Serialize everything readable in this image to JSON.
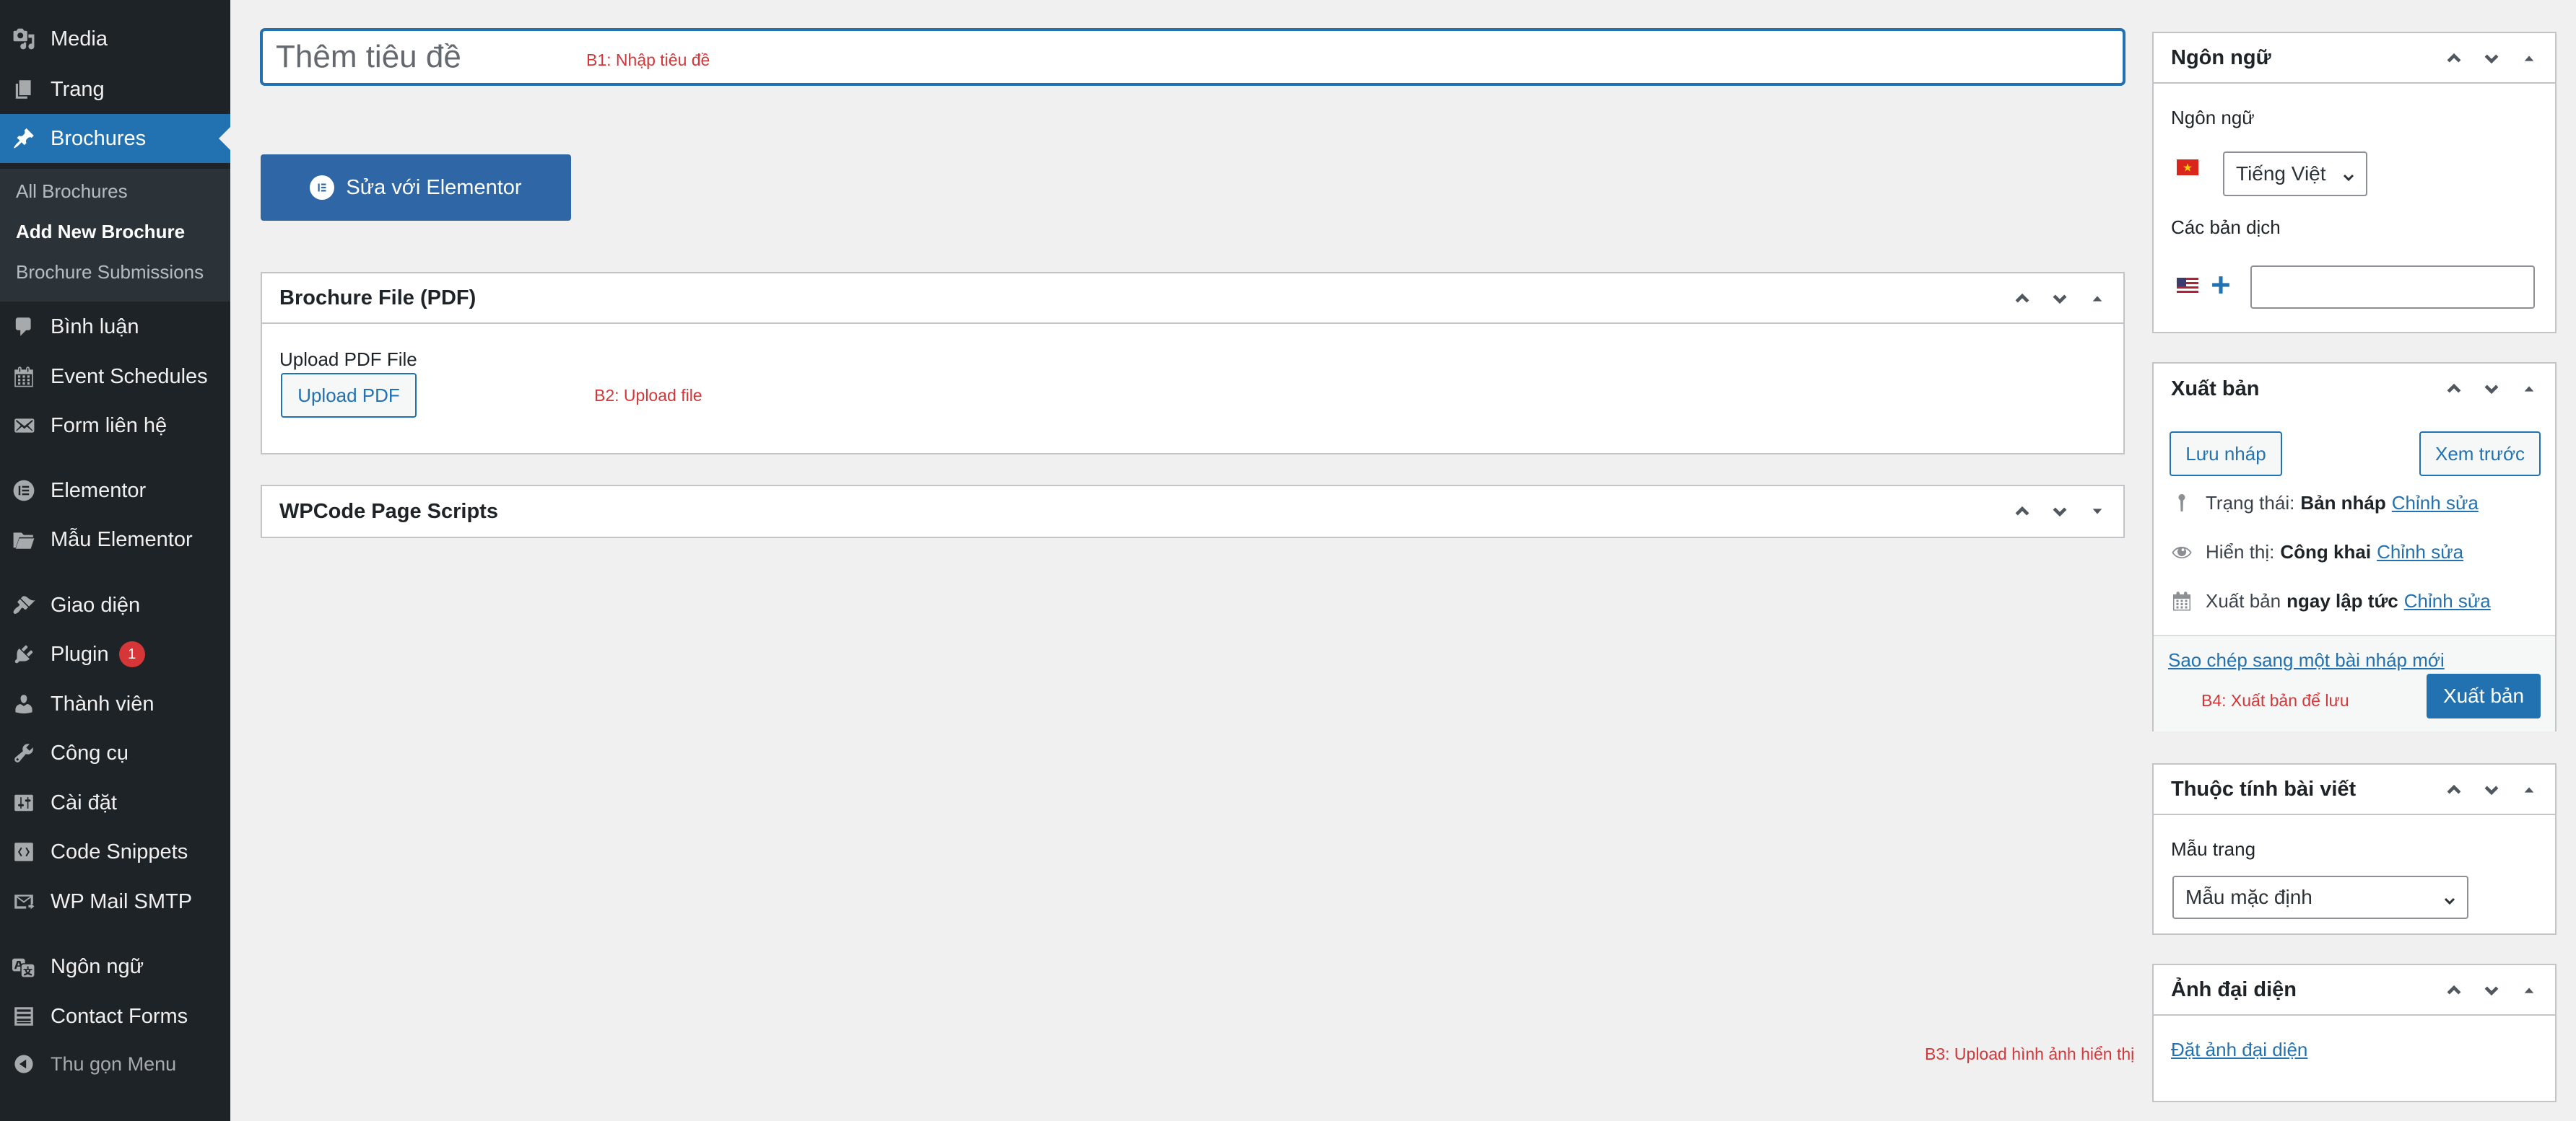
{
  "sidebar": {
    "items": [
      {
        "label": "Media",
        "icon": "media-icon"
      },
      {
        "label": "Trang",
        "icon": "page-icon"
      },
      {
        "label": "Brochures",
        "icon": "pin-icon"
      },
      {
        "label": "Bình luận",
        "icon": "comment-icon"
      },
      {
        "label": "Event Schedules",
        "icon": "calendar-icon"
      },
      {
        "label": "Form liên hệ",
        "icon": "mail-icon"
      },
      {
        "label": "Elementor",
        "icon": "elementor-icon"
      },
      {
        "label": "Mẫu Elementor",
        "icon": "folder-icon"
      },
      {
        "label": "Giao diện",
        "icon": "brush-icon"
      },
      {
        "label": "Plugin",
        "icon": "plugin-icon",
        "badge": "1"
      },
      {
        "label": "Thành viên",
        "icon": "user-icon"
      },
      {
        "label": "Công cụ",
        "icon": "wrench-icon"
      },
      {
        "label": "Cài đặt",
        "icon": "settings-icon"
      },
      {
        "label": "Code Snippets",
        "icon": "code-icon"
      },
      {
        "label": "WP Mail SMTP",
        "icon": "mail-smtp-icon"
      },
      {
        "label": "Ngôn ngữ",
        "icon": "translate-icon"
      },
      {
        "label": "Contact Forms",
        "icon": "list-icon"
      }
    ],
    "submenu": [
      "All Brochures",
      "Add New Brochure",
      "Brochure Submissions"
    ],
    "collapse_label": "Thu gọn Menu",
    "accent": "#2271b1"
  },
  "editor": {
    "title_placeholder": "Thêm tiêu đề",
    "note_title": "B1: Nhập tiêu đề",
    "elementor_button": "Sửa với Elementor",
    "note_upload": "B2: Upload file",
    "note_image": "B3: Upload hình ảnh hiển thị",
    "note_publish": "B4: Xuất bản để lưu"
  },
  "boxes": {
    "brochure_file": {
      "title": "Brochure File (PDF)",
      "field_label": "Upload PDF File",
      "button": "Upload PDF"
    },
    "wpcode": {
      "title": "WPCode Page Scripts"
    },
    "language": {
      "title": "Ngôn ngữ",
      "language_label": "Ngôn ngữ",
      "selected_language": "Tiếng Việt",
      "translations_label": "Các bản dịch",
      "translation_value": ""
    },
    "publish": {
      "title": "Xuất bản",
      "save_draft": "Lưu nháp",
      "preview": "Xem trước",
      "status_label": "Trạng thái:",
      "status_value": "Bản nháp",
      "visibility_label": "Hiển thị:",
      "visibility_value": "Công khai",
      "schedule_label": "Xuất bản",
      "schedule_value": "ngay lập tức",
      "edit_link": "Chỉnh sửa",
      "copy_link": "Sao chép sang một bài nháp mới",
      "publish_button": "Xuất bản"
    },
    "attributes": {
      "title": "Thuộc tính bài viết",
      "template_label": "Mẫu trang",
      "template_value": "Mẫu mặc định"
    },
    "featured": {
      "title": "Ảnh đại diện",
      "set_link": "Đặt ảnh đại diện"
    }
  }
}
